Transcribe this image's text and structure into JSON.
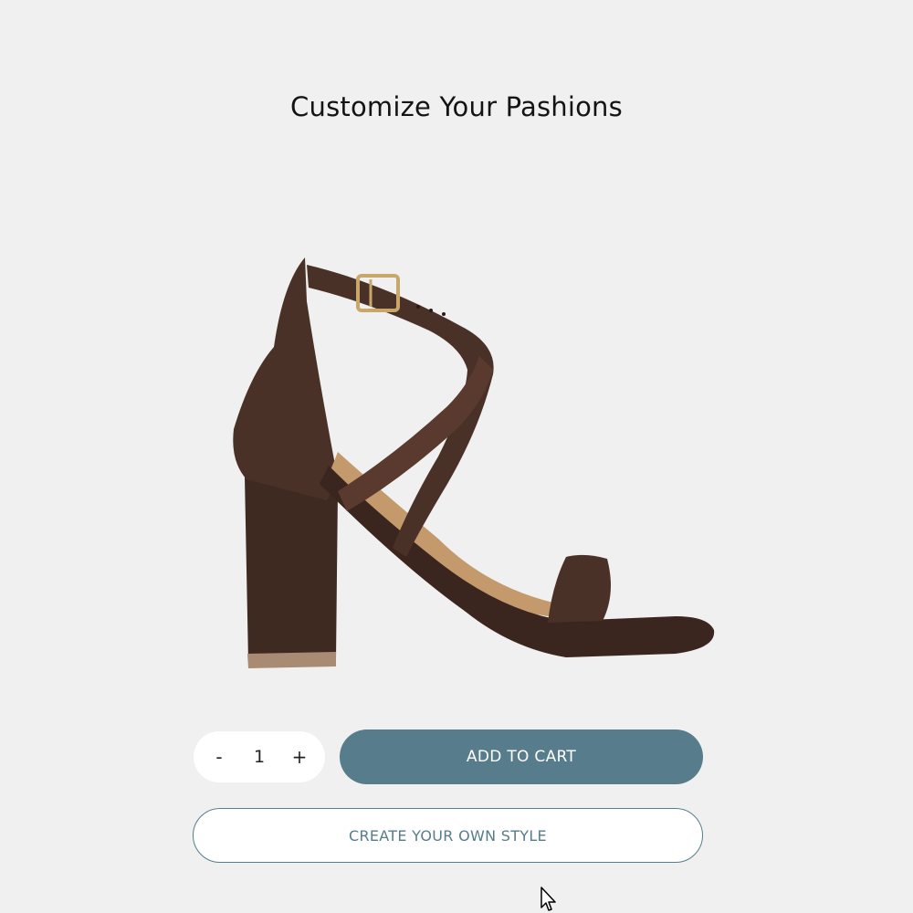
{
  "page": {
    "title": "Customize Your Pashions"
  },
  "product": {
    "image_icon": "sandal-image",
    "colors": {
      "leather": "#4a3128",
      "leather_dark": "#3a261e",
      "lining": "#c49a6c",
      "heel_tip": "#a88b72",
      "buckle": "#c9a76a"
    }
  },
  "quantity": {
    "decrement_label": "-",
    "value": "1",
    "increment_label": "+"
  },
  "actions": {
    "add_to_cart_label": "ADD TO CART",
    "create_style_label": "CREATE YOUR OWN STYLE"
  },
  "colors": {
    "background": "#f0f0f0",
    "accent": "#577c8b",
    "white": "#ffffff"
  },
  "cursor": {
    "icon": "mouse-pointer-icon"
  }
}
